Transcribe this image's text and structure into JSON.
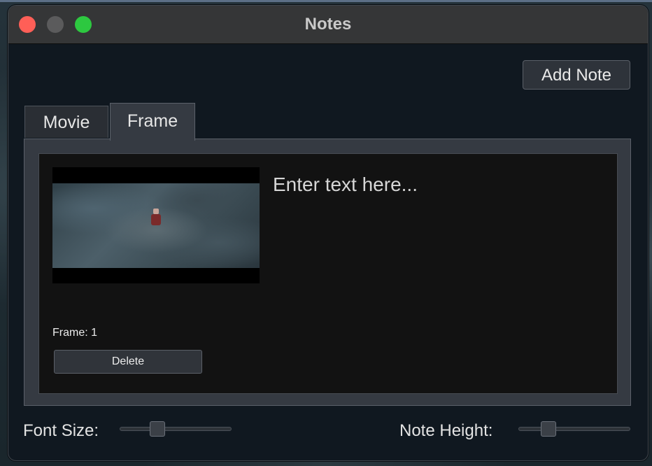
{
  "window": {
    "title": "Notes"
  },
  "toolbar": {
    "add_note_label": "Add Note"
  },
  "tabs": [
    {
      "label": "Movie",
      "selected": false
    },
    {
      "label": "Frame",
      "selected": true
    }
  ],
  "notes": [
    {
      "frame_label": "Frame: 1",
      "delete_label": "Delete",
      "text_value": "",
      "text_placeholder": "Enter text here..."
    }
  ],
  "footer": {
    "font_size_label": "Font Size:",
    "font_size_value": 0.31,
    "note_height_label": "Note Height:",
    "note_height_value": 0.23
  },
  "colors": {
    "close_button": "#ff5f57",
    "minimize_button": "#5b5b5c",
    "zoom_button": "#2dc840",
    "window_background": "#101820",
    "card_background": "#121212"
  }
}
